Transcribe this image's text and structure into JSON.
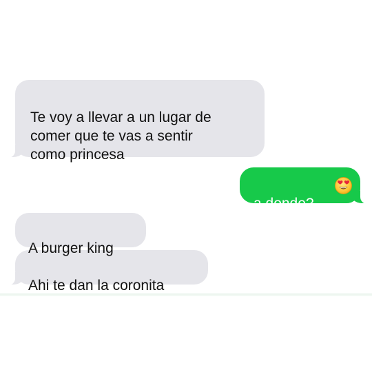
{
  "conversation": {
    "messages": [
      {
        "direction": "incoming",
        "text": "Te voy a llevar a un lugar de\ncomer que te vas a sentir\ncomo  princesa"
      },
      {
        "direction": "outgoing",
        "text": "a donde?",
        "emoji": "heart-eyes-emoji"
      },
      {
        "direction": "incoming",
        "text": "A burger king"
      },
      {
        "direction": "incoming",
        "text": "Ahi te dan la coronita"
      }
    ]
  },
  "colors": {
    "incoming_bubble": "#e5e5ea",
    "outgoing_bubble": "#17c94a",
    "incoming_text": "#111111",
    "outgoing_text": "#ffffff",
    "background": "#ffffff"
  }
}
